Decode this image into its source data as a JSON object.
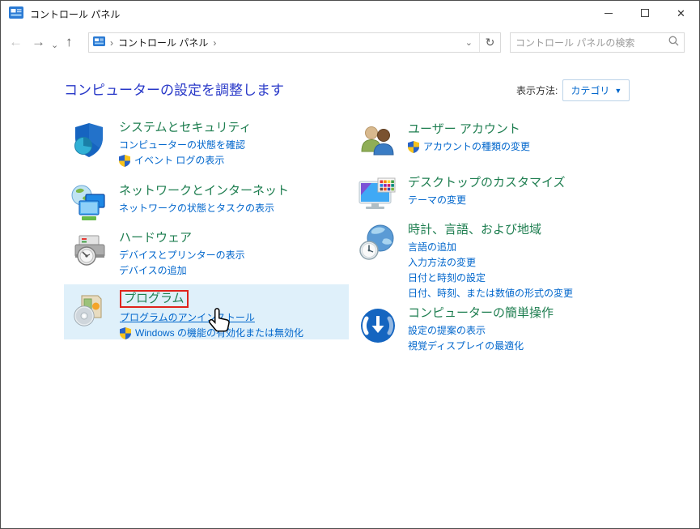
{
  "window": {
    "title": "コントロール パネル"
  },
  "navbar": {
    "breadcrumb": {
      "item": "コントロール パネル"
    },
    "search": {
      "placeholder": "コントロール パネルの検索"
    }
  },
  "header": {
    "title": "コンピューターの設定を調整します",
    "view_by_label": "表示方法:",
    "view_by_value": "カテゴリ"
  },
  "categories": [
    {
      "title": "システムとセキュリティ",
      "icon": "shield-pie-icon",
      "links": [
        {
          "label": "コンピューターの状態を確認"
        },
        {
          "label": "イベント ログの表示",
          "shield": true
        }
      ]
    },
    {
      "title": "ネットワークとインターネット",
      "icon": "globe-monitors-icon",
      "links": [
        {
          "label": "ネットワークの状態とタスクの表示"
        }
      ]
    },
    {
      "title": "ハードウェア",
      "icon": "printer-gauge-icon",
      "links": [
        {
          "label": "デバイスとプリンターの表示"
        },
        {
          "label": "デバイスの追加"
        }
      ]
    },
    {
      "title": "プログラム",
      "icon": "software-box-cd-icon",
      "hovered": true,
      "annotated": true,
      "links": [
        {
          "label": "プログラムのアンインストール",
          "underlined": true
        },
        {
          "label": "Windows の機能の有効化または無効化",
          "shield": true
        }
      ]
    },
    {
      "title": "ユーザー アカウント",
      "icon": "two-users-icon",
      "links": [
        {
          "label": "アカウントの種類の変更",
          "shield": true
        }
      ]
    },
    {
      "title": "デスクトップのカスタマイズ",
      "icon": "monitor-palette-icon",
      "links": [
        {
          "label": "テーマの変更"
        }
      ]
    },
    {
      "title": "時計、言語、および地域",
      "icon": "globe-clock-icon",
      "links": [
        {
          "label": "言語の追加"
        },
        {
          "label": "入力方法の変更"
        },
        {
          "label": "日付と時刻の設定"
        },
        {
          "label": "日付、時刻、または数値の形式の変更"
        }
      ]
    },
    {
      "title": "コンピューターの簡単操作",
      "icon": "ease-of-access-icon",
      "links": [
        {
          "label": "設定の提案の表示"
        },
        {
          "label": "視覚ディスプレイの最適化"
        }
      ]
    }
  ],
  "colors": {
    "category_title": "#1e7e50",
    "task_link": "#0066cc",
    "heading": "#2838c8",
    "annotation_red": "#e0241c",
    "hover_bg": "#dff0fa"
  }
}
